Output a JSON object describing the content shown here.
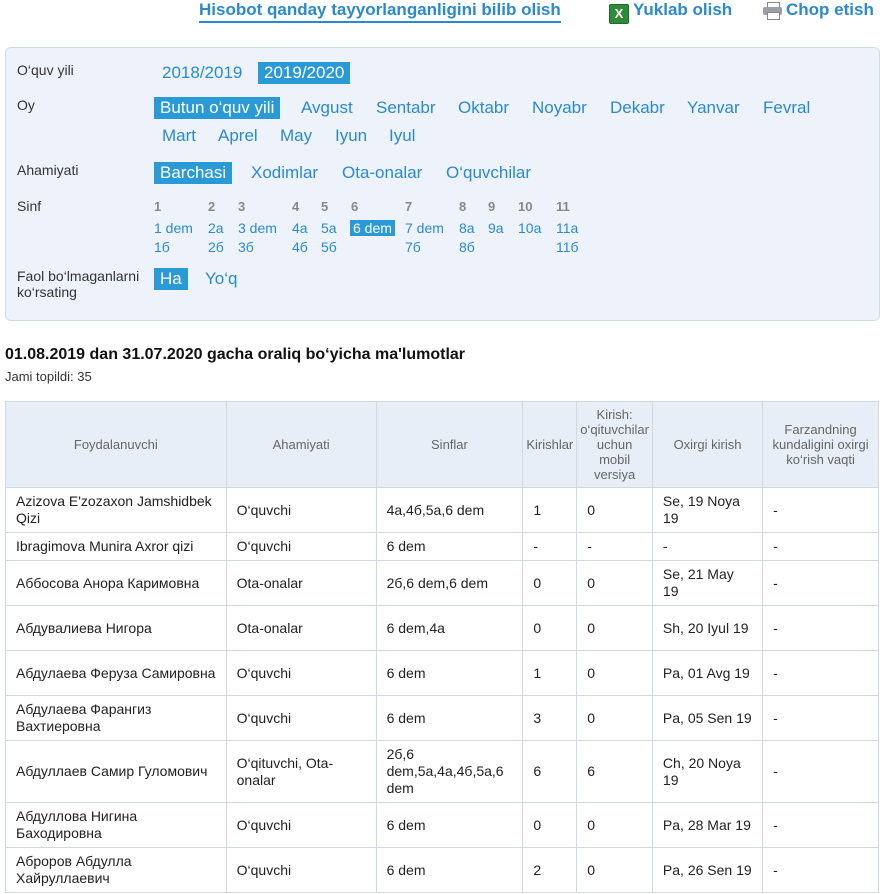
{
  "top": {
    "how_link": "Hisobot qanday tayyorlanganligini bilib olish",
    "download": "Yuklab olish",
    "print": "Chop etish"
  },
  "filters": {
    "year_label": "O‘quv yili",
    "years": [
      "2018/2019",
      "2019/2020"
    ],
    "month_label": "Oy",
    "months_row1": [
      "Butun o‘quv yili",
      "Avgust",
      "Sentabr",
      "Oktabr",
      "Noyabr",
      "Dekabr",
      "Yanvar",
      "Fevral"
    ],
    "months_row2": [
      "Mart",
      "Aprel",
      "May",
      "Iyun",
      "Iyul"
    ],
    "role_label": "Ahamiyati",
    "roles": [
      "Barchasi",
      "Xodimlar",
      "Ota-onalar",
      "O‘quvchilar"
    ],
    "class_label": "Sinf",
    "class_heads": [
      "1",
      "2",
      "3",
      "4",
      "5",
      "6",
      "7",
      "8",
      "9",
      "10",
      "11"
    ],
    "class_opts": {
      "c1": [
        "1 dem",
        "1б"
      ],
      "c2": [
        "2a",
        "2б"
      ],
      "c3": [
        "3 dem",
        "3б"
      ],
      "c4": [
        "4a",
        "4б"
      ],
      "c5": [
        "5a",
        "5б"
      ],
      "c6": [
        "6 dem"
      ],
      "c7": [
        "7 dem",
        "7б"
      ],
      "c8": [
        "8a",
        "8б"
      ],
      "c9": [
        "9a"
      ],
      "c10": [
        "10a"
      ],
      "c11": [
        "11a",
        "11б"
      ]
    },
    "inactive_label": "Faol bo‘lmaganlarni ko‘rsating",
    "inactive_opts": [
      "Ha",
      "Yo‘q"
    ]
  },
  "result": {
    "title": "01.08.2019 dan 31.07.2020 gacha oraliq bo‘yicha ma'lumotlar",
    "count": "Jami topildi: 35"
  },
  "table": {
    "headers": [
      "Foydalanuvchi",
      "Ahamiyati",
      "Sinflar",
      "Kirishlar",
      "Kirish: o‘qituvchilar uchun mobil versiya",
      "Oxirgi kirish",
      "Farzandning kundaligini oxirgi ko‘rish vaqti"
    ],
    "rows": [
      [
        "Azizova E'zozaxon Jamshidbek Qizi",
        "O‘quvchi",
        "4a,4б,5a,6 dem",
        "1",
        "0",
        "Se, 19 Noya 19",
        "-"
      ],
      [
        "Ibragimova Munira Axror qizi",
        "O‘quvchi",
        "6 dem",
        "-",
        "-",
        "-",
        "-"
      ],
      [
        "Аббосова Анора Каримовна",
        "Ota-onalar",
        "2б,6 dem,6 dem",
        "0",
        "0",
        "Se, 21 May 19",
        "-"
      ],
      [
        "Абдувалиева Нигора",
        "Ota-onalar",
        "6 dem,4a",
        "0",
        "0",
        "Sh, 20 Iyul 19",
        "-"
      ],
      [
        "Абдулаева Феруза Самировна",
        "O‘quvchi",
        "6 dem",
        "1",
        "0",
        "Pa, 01 Avg 19",
        "-"
      ],
      [
        "Абдулаева Фарангиз Вахтиеровна",
        "O‘quvchi",
        "6 dem",
        "3",
        "0",
        "Pa, 05 Sen 19",
        "-"
      ],
      [
        "Абдуллаев Самир Гуломович",
        "O‘qituvchi, Ota-onalar",
        "2б,6 dem,5a,4a,4б,5a,6 dem",
        "6",
        "6",
        "Ch, 20 Noya 19",
        "-"
      ],
      [
        "Абдуллова Нигина Баходировна",
        "O‘quvchi",
        "6 dem",
        "0",
        "0",
        "Pa, 28 Mar 19",
        "-"
      ],
      [
        "Аброров Абдулла Хайруллаевич",
        "O‘quvchi",
        "6 dem",
        "2",
        "0",
        "Pa, 26 Sen 19",
        "-"
      ]
    ]
  }
}
